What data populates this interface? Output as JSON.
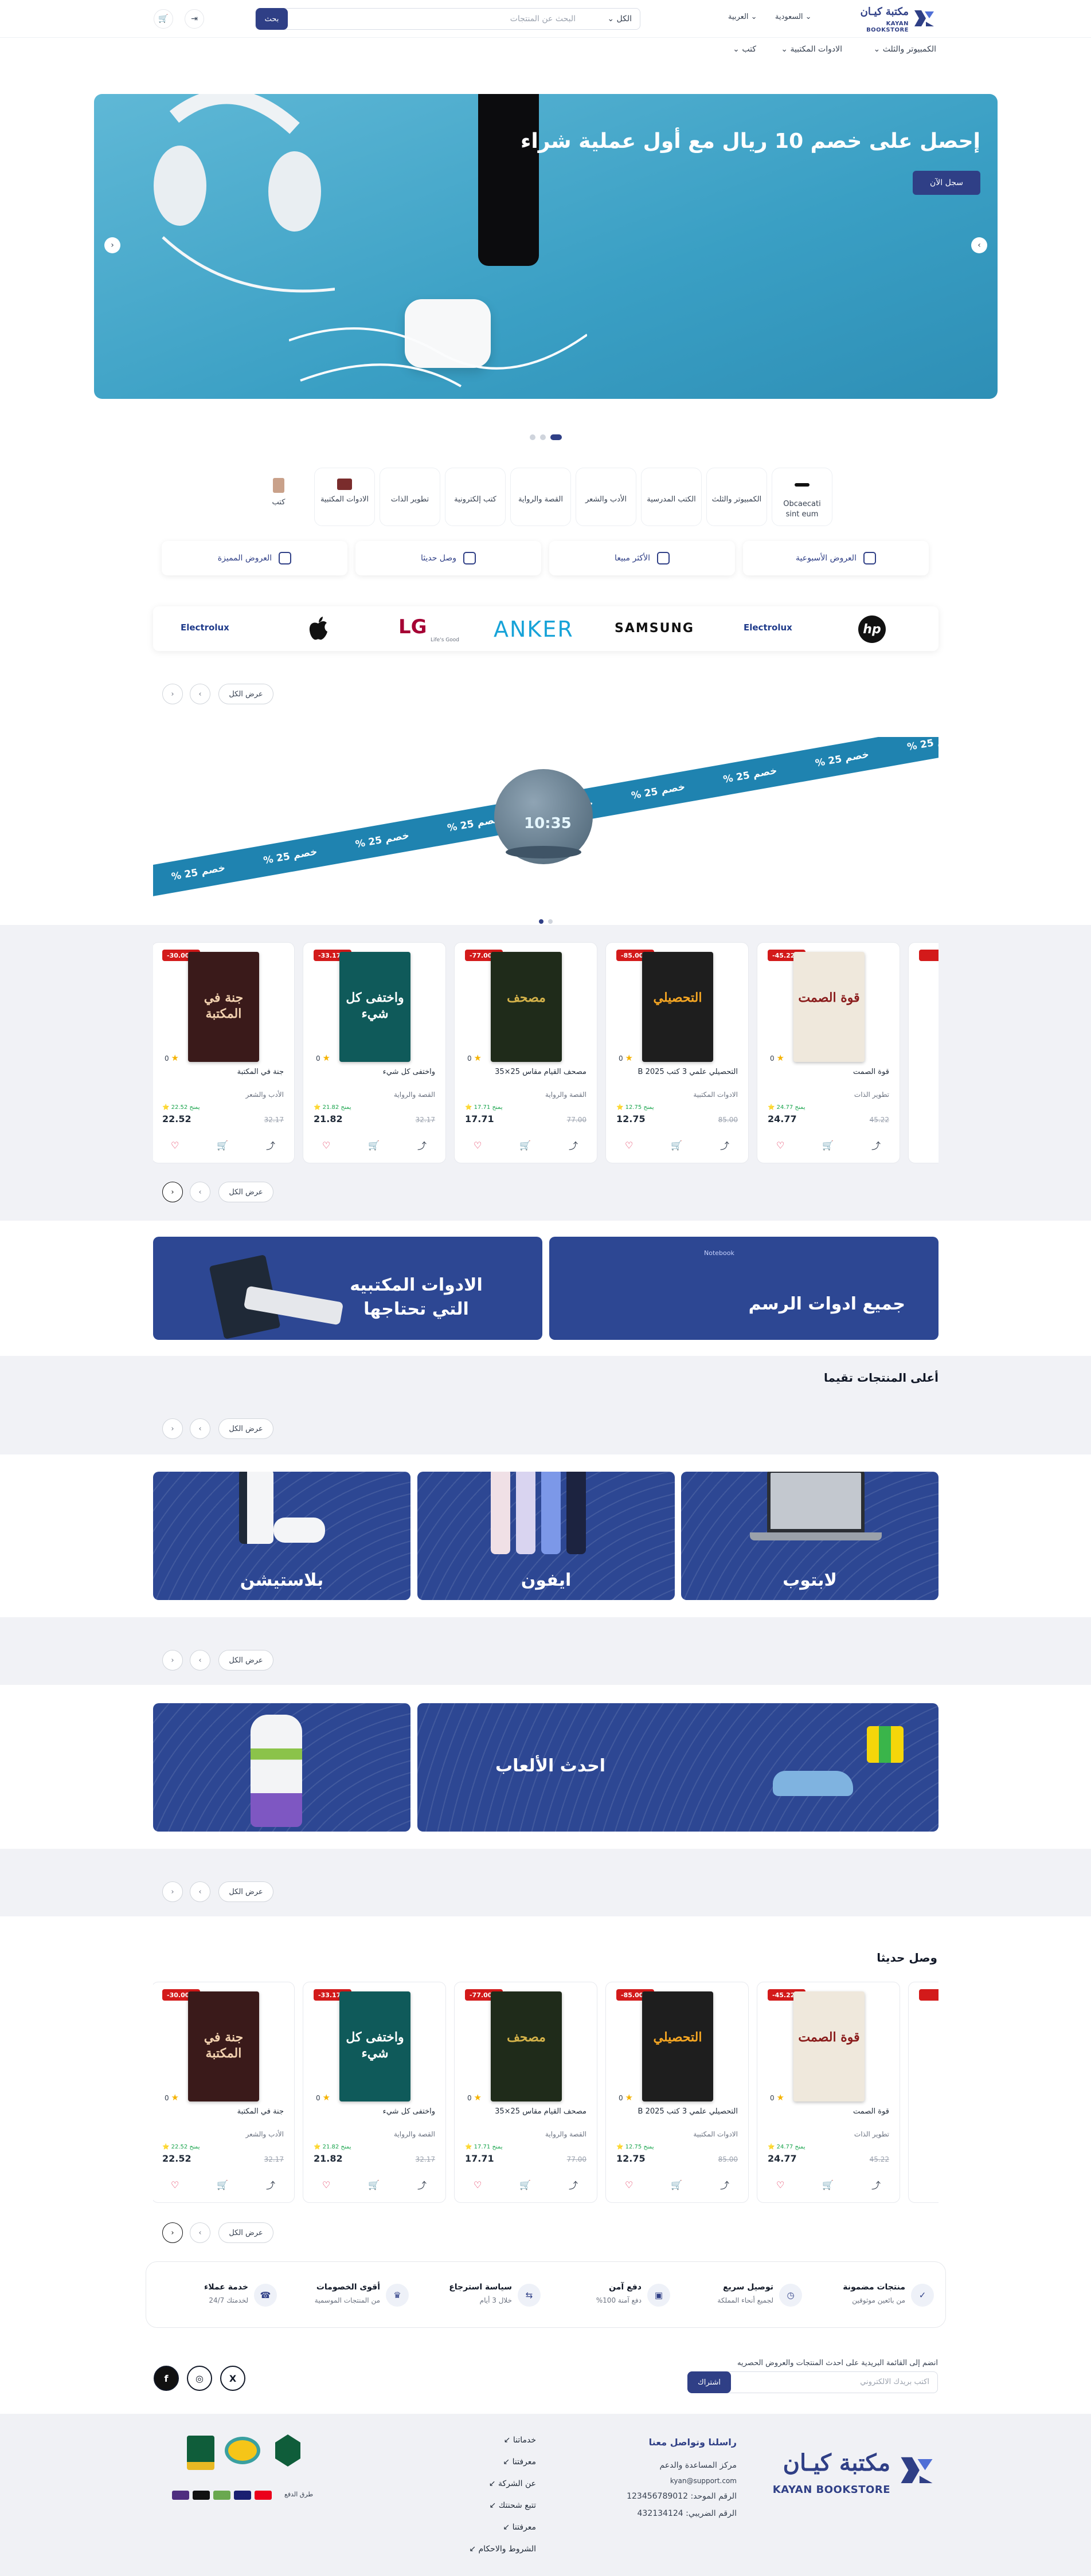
{
  "header": {
    "logo_ar": "مكتبة كيـان",
    "logo_en": "KAYAN BOOKSTORE",
    "country": "السعودية",
    "language": "العربية",
    "search_scope": "الكل",
    "search_placeholder": "البحث عن المنتجات",
    "search_button": "بحث"
  },
  "nav": {
    "items": [
      "الكمبيوتر والثلث",
      "الادوات المكتبية",
      "كتب"
    ]
  },
  "hero": {
    "title": "إحصل على خصم 10 ريال مع أول عملية شراء",
    "button": "سجل الآن"
  },
  "categories": [
    {
      "label": "Obcaecati sint eum"
    },
    {
      "label": "الكمبيوتر والثلث"
    },
    {
      "label": "الكتب المدرسية"
    },
    {
      "label": "الأدب والشعر"
    },
    {
      "label": "القصة والرواية"
    },
    {
      "label": "كتب إلكترونية"
    },
    {
      "label": "تطوير الذات"
    },
    {
      "label": "الادوات المكتبية"
    },
    {
      "label": "كتب"
    }
  ],
  "tabs": [
    "العروض الأسبوعية",
    "الأكثر مبيعا",
    "وصل حديثا",
    "العروض المميزة"
  ],
  "brands": [
    "hp",
    "Electrolux",
    "SAMSUNG",
    "ANKER",
    "LG",
    "Life's Good",
    "",
    "Electrolux"
  ],
  "controls": {
    "view_all": "عرض الكل"
  },
  "ribbon": {
    "text": "خصم 25 %",
    "clock": "10:35"
  },
  "products": [
    {
      "discount": "45.22%-",
      "cover": "قوة الصمت",
      "name": "قوة الصمت",
      "category": "تطوير الذات",
      "points": "يمنح 24.77 ⭐",
      "old": "45.22",
      "price": "24.77",
      "rating": "0",
      "bg": "#efe8dc",
      "fg": "#8a1c1c"
    },
    {
      "discount": "85.00%-",
      "cover": "التحصيلي",
      "name": "التحصيلي علمي 3 كتب 2025 B",
      "category": "الادوات المكتبية",
      "points": "يمنح 12.75 ⭐",
      "old": "85.00",
      "price": "12.75",
      "rating": "0",
      "bg": "#1e1e1e",
      "fg": "#f5a623"
    },
    {
      "discount": "77.00%-",
      "cover": "مصحف",
      "name": "مصحف القيام مقاس 25×35",
      "category": "القصة والرواية",
      "points": "يمنح 17.71 ⭐",
      "old": "77.00",
      "price": "17.71",
      "rating": "0",
      "bg": "#1f2b1a",
      "fg": "#d4b24a"
    },
    {
      "discount": "33.17%-",
      "cover": "واختفى كل شيء",
      "name": "واختفى كل شيء",
      "category": "القصة والرواية",
      "points": "يمنح 21.82 ⭐",
      "old": "32.17",
      "price": "21.82",
      "rating": "0",
      "bg": "#0f5a5a",
      "fg": "#ffffff"
    },
    {
      "discount": "30.00%-",
      "cover": "جنة في المكتبة",
      "name": "جنة في المكتبة",
      "category": "الأدب والشعر",
      "points": "يمنح 22.52 ⭐",
      "old": "32.17",
      "price": "22.52",
      "rating": "0",
      "bg": "#3a1a1a",
      "fg": "#f3d2b0"
    }
  ],
  "promo": {
    "drawing_tools": "جميع ادوات الرسم",
    "drawing_tag": "Notebook",
    "office_tools": "الادوات المكتبيه التي تحتاجها",
    "top_rated": "أعلى المنتجات تقيما",
    "laptop": "لابتوب",
    "iphone": "ايفون",
    "playstation": "بلاستيشن",
    "games": "احدث الألعاب",
    "new_arrivals": "وصل حديثا"
  },
  "features": [
    {
      "title": "منتجات مضمونة",
      "sub": "من بائعين موثوقين",
      "icon": "✓"
    },
    {
      "title": "توصيل سريع",
      "sub": "لجميع أنحاء المملكة",
      "icon": "◷"
    },
    {
      "title": "دفع آمن",
      "sub": "دفع آمنة 100%",
      "icon": "▣"
    },
    {
      "title": "سياسة استرجاع",
      "sub": "خلال 3 أيام",
      "icon": "⇆"
    },
    {
      "title": "أقوى الخصومات",
      "sub": "من المنتجات الموسمية",
      "icon": "♛"
    },
    {
      "title": "خدمة عملاء",
      "sub": "لخدمتك 24/7",
      "icon": "☎"
    }
  ],
  "newsletter": {
    "label": "انضم إلى القائمة البريدية على احدث المنتجات والعروض الحصريه",
    "placeholder": "اكتب بريدك الالكتروني",
    "button": "اشتراك"
  },
  "social": [
    "f",
    "◎",
    "X"
  ],
  "footer": {
    "contact_title": "راسلنا وتواصل معنا",
    "center": "مركز المساعدة والدعم",
    "email": "kyan@support.com",
    "phone": "الرقم الموحد: 123456789012",
    "tax": "الرقم الضريبي: 432134124",
    "links": [
      "خدماتنا",
      "معرفتنا",
      "عن الشركة",
      "تتبع شحنتك",
      "معرفتنا",
      "الشروط والاحكام"
    ],
    "payment_label": "طرق الدفع"
  },
  "colors": {
    "primary": "#2f3f86",
    "sale": "#d31a1a",
    "ribbon": "#1f83b0",
    "banner": "#2d4793"
  }
}
